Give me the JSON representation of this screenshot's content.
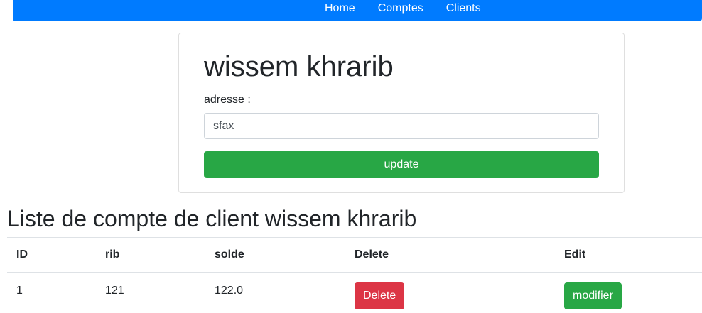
{
  "navbar": {
    "links": [
      {
        "label": "Home"
      },
      {
        "label": "Comptes"
      },
      {
        "label": "Clients"
      }
    ]
  },
  "client_card": {
    "name": "wissem khrarib",
    "address_label": "adresse :",
    "address_value": "sfax",
    "update_label": "update"
  },
  "accounts": {
    "title": "Liste de compte de client wissem khrarib",
    "columns": [
      "ID",
      "rib",
      "solde",
      "Delete",
      "Edit"
    ],
    "rows": [
      {
        "id": "1",
        "rib": "121",
        "solde": "122.0",
        "delete_label": "Delete",
        "edit_label": "modifier"
      }
    ]
  },
  "colors": {
    "navbar": "#007bff",
    "success": "#28a745",
    "danger": "#dc3545"
  }
}
